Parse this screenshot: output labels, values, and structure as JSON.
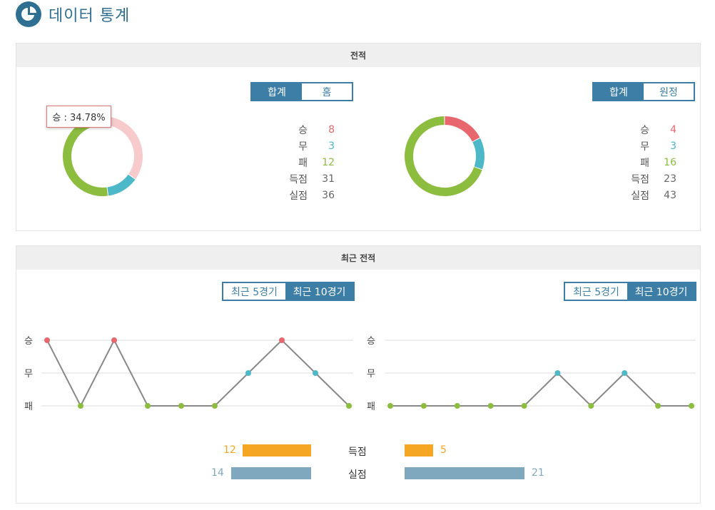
{
  "header": {
    "title": "데이터 통계"
  },
  "colors": {
    "win": "#e8676e",
    "draw": "#4db8c8",
    "loss": "#8dbd3f",
    "accent": "#3d7ea6",
    "goals_for": "#f5a623",
    "goals_against": "#7fa8bf"
  },
  "record": {
    "title": "전적",
    "left": {
      "tabs": [
        {
          "label": "합계",
          "active": true
        },
        {
          "label": "홈",
          "active": false
        }
      ],
      "stats": [
        {
          "label": "승",
          "value": "8"
        },
        {
          "label": "무",
          "value": "3"
        },
        {
          "label": "패",
          "value": "12"
        },
        {
          "label": "득점",
          "value": "31"
        },
        {
          "label": "실점",
          "value": "36"
        }
      ],
      "tooltip": "승 : 34.78%"
    },
    "right": {
      "tabs": [
        {
          "label": "합계",
          "active": true
        },
        {
          "label": "원정",
          "active": false
        }
      ],
      "stats": [
        {
          "label": "승",
          "value": "4"
        },
        {
          "label": "무",
          "value": "3"
        },
        {
          "label": "패",
          "value": "16"
        },
        {
          "label": "득점",
          "value": "23"
        },
        {
          "label": "실점",
          "value": "43"
        }
      ]
    }
  },
  "recent": {
    "title": "최근 전적",
    "left_tabs": [
      {
        "label": "최근 5경기",
        "active": false
      },
      {
        "label": "최근 10경기",
        "active": true
      }
    ],
    "right_tabs": [
      {
        "label": "최근 5경기",
        "active": false
      },
      {
        "label": "최근 10경기",
        "active": true
      }
    ],
    "y_labels": [
      "승",
      "무",
      "패"
    ],
    "goals_label": "득점",
    "conceded_label": "실점",
    "left_goals": "12",
    "left_conceded": "14",
    "right_goals": "5",
    "right_conceded": "21"
  },
  "chart_data": [
    {
      "type": "pie",
      "categories": [
        "승",
        "무",
        "패"
      ],
      "values": [
        8,
        3,
        12
      ]
    },
    {
      "type": "pie",
      "categories": [
        "승",
        "무",
        "패"
      ],
      "values": [
        4,
        3,
        16
      ]
    },
    {
      "type": "line",
      "y_categories": [
        "승",
        "무",
        "패"
      ],
      "values": [
        "승",
        "패",
        "승",
        "패",
        "패",
        "패",
        "무",
        "승",
        "무",
        "패"
      ]
    },
    {
      "type": "line",
      "y_categories": [
        "승",
        "무",
        "패"
      ],
      "values": [
        "패",
        "패",
        "패",
        "패",
        "패",
        "무",
        "패",
        "무",
        "패",
        "패"
      ]
    },
    {
      "type": "bar",
      "categories": [
        "득점",
        "실점"
      ],
      "series": [
        {
          "values": [
            12,
            14
          ]
        },
        {
          "values": [
            5,
            21
          ]
        }
      ]
    }
  ]
}
